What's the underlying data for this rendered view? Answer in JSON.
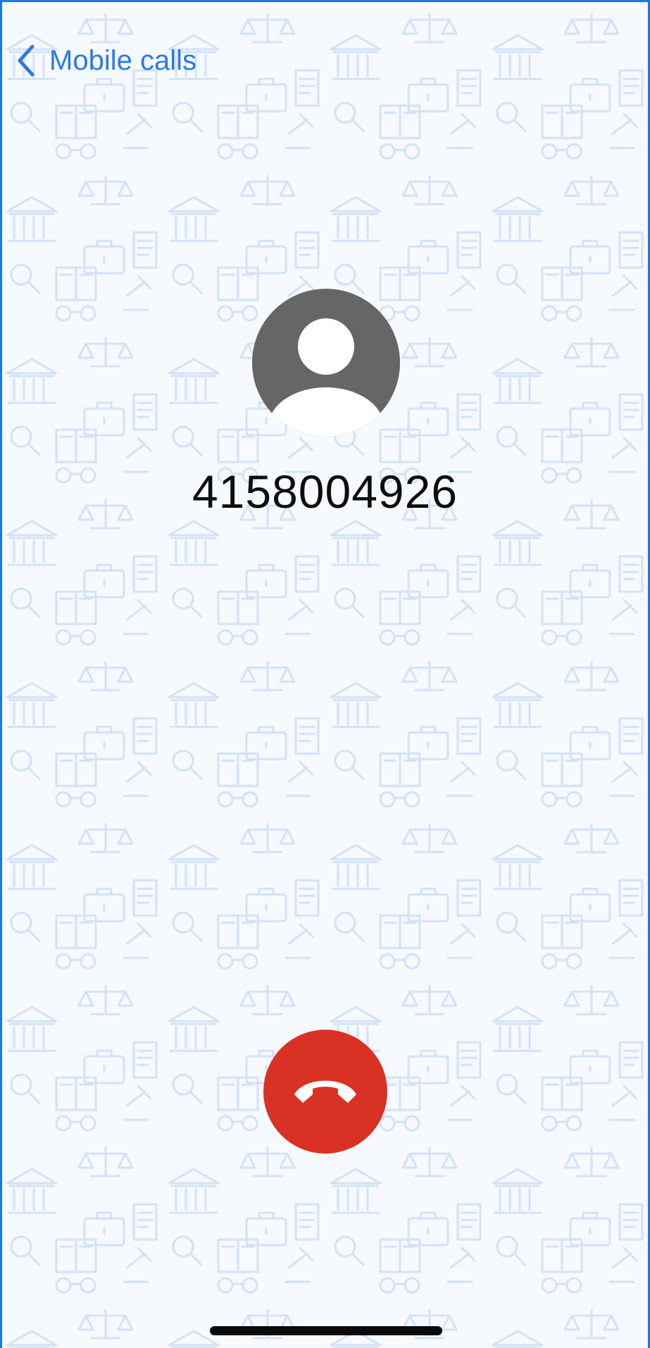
{
  "nav": {
    "back_label": "Mobile calls",
    "back_icon": "chevron-left-icon"
  },
  "call": {
    "number": "4158004926",
    "avatar_icon": "person-avatar-icon",
    "end_call_icon": "phone-hangup-icon"
  },
  "colors": {
    "accent": "#2a7ae4",
    "end_call": "#d93124",
    "avatar": "#666666",
    "pattern": "#cfe0f7"
  }
}
